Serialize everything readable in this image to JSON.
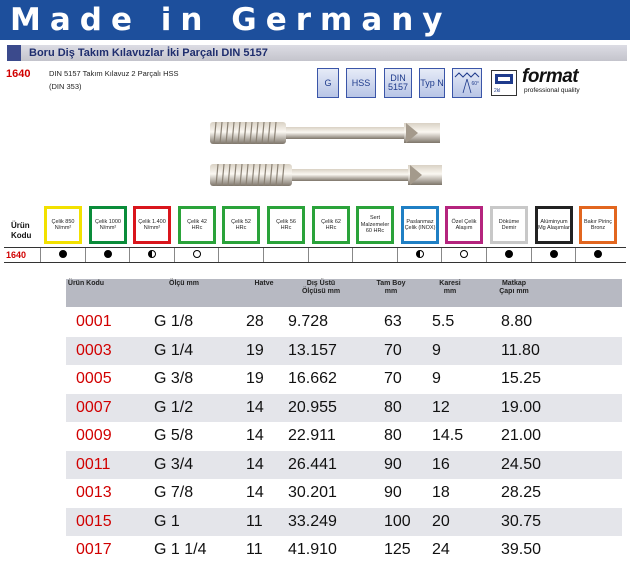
{
  "banner": {
    "text": "Made in Germany"
  },
  "header": {
    "title": "Boru Diş Takım Kılavuzlar İki Parçalı DIN 5157",
    "code": "1640",
    "desc_line1": "DIN 5157 Takım Kılavuz 2 Parçalı HSS",
    "desc_line2": "(DIN 353)"
  },
  "badges": [
    {
      "label": "G"
    },
    {
      "label": "HSS"
    },
    {
      "label": "DIN 5157"
    },
    {
      "label": "Typ N"
    }
  ],
  "angle_label": "60°",
  "grade_label": "2kl",
  "logo": {
    "name": "format",
    "tagline": "professional quality"
  },
  "materials": {
    "header": "Ürün Kodu",
    "code": "1640",
    "items": [
      {
        "label": "Çelik 850 N/mm²",
        "color": "#f2e100",
        "suit": "full"
      },
      {
        "label": "Çelik 1000 N/mm²",
        "color": "#0a8c3a",
        "suit": "full"
      },
      {
        "label": "Çelik 1.400 N/mm²",
        "color": "#d9151c",
        "suit": "half"
      },
      {
        "label": "Çelik 42 HRc",
        "color": "#2aa33a",
        "suit": "empty"
      },
      {
        "label": "Çelik 52 HRc",
        "color": "#2aa33a",
        "suit": "none"
      },
      {
        "label": "Çelik 56 HRc",
        "color": "#2aa33a",
        "suit": "none"
      },
      {
        "label": "Çelik 62 HRc",
        "color": "#2aa33a",
        "suit": "none"
      },
      {
        "label": "Sert Malzemeler 60 HRc",
        "color": "#2aa33a",
        "suit": "none"
      },
      {
        "label": "Paslanmaz Çelik (INOX)",
        "color": "#1f7fc4",
        "suit": "half"
      },
      {
        "label": "Özel Çelik Alaşım",
        "color": "#b5247e",
        "suit": "empty"
      },
      {
        "label": "Döküme Demir",
        "color": "#c8c8c8",
        "suit": "full"
      },
      {
        "label": "Alüminyum Mg Alaşımlar",
        "color": "#222222",
        "suit": "full"
      },
      {
        "label": "Bakır Pirinç Bronz",
        "color": "#e2661f",
        "suit": "full"
      }
    ]
  },
  "table": {
    "headers": {
      "code": "Ürün Kodu",
      "size": "Ölçü mm",
      "pitch": "Hatve",
      "outer": "Dış Üstü Ölçüsü mm",
      "length": "Tam Boy mm",
      "square": "Karesi mm",
      "drill": "Matkap Çapı mm"
    },
    "rows": [
      {
        "code": "0001",
        "size": "G 1/8",
        "pitch": "28",
        "outer": "9.728",
        "length": "63",
        "square": "5.5",
        "drill": "8.80"
      },
      {
        "code": "0003",
        "size": "G 1/4",
        "pitch": "19",
        "outer": "13.157",
        "length": "70",
        "square": "9",
        "drill": "11.80"
      },
      {
        "code": "0005",
        "size": "G 3/8",
        "pitch": "19",
        "outer": "16.662",
        "length": "70",
        "square": "9",
        "drill": "15.25"
      },
      {
        "code": "0007",
        "size": "G 1/2",
        "pitch": "14",
        "outer": "20.955",
        "length": "80",
        "square": "12",
        "drill": "19.00"
      },
      {
        "code": "0009",
        "size": "G 5/8",
        "pitch": "14",
        "outer": "22.911",
        "length": "80",
        "square": "14.5",
        "drill": "21.00"
      },
      {
        "code": "0011",
        "size": "G 3/4",
        "pitch": "14",
        "outer": "26.441",
        "length": "90",
        "square": "16",
        "drill": "24.50"
      },
      {
        "code": "0013",
        "size": "G 7/8",
        "pitch": "14",
        "outer": "30.201",
        "length": "90",
        "square": "18",
        "drill": "28.25"
      },
      {
        "code": "0015",
        "size": "G 1",
        "pitch": "11",
        "outer": "33.249",
        "length": "100",
        "square": "20",
        "drill": "30.75"
      },
      {
        "code": "0017",
        "size": "G 1 1/4",
        "pitch": "11",
        "outer": "41.910",
        "length": "125",
        "square": "24",
        "drill": "39.50"
      }
    ]
  }
}
